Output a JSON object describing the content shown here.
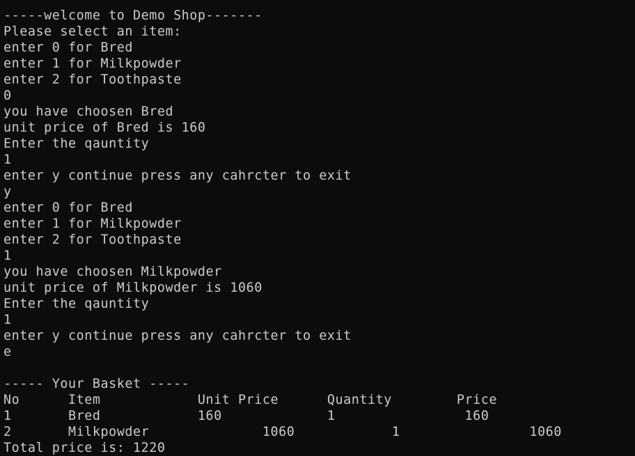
{
  "terminal": {
    "lines": [
      "",
      "-----welcome to Demo Shop-------",
      "Please select an item:",
      "enter 0 for Bred",
      "enter 1 for Milkpowder",
      "enter 2 for Toothpaste",
      "0",
      "you have choosen Bred",
      "unit price of Bred is 160",
      "Enter the qauntity",
      "1",
      "enter y continue press any cahrcter to exit",
      "y",
      "enter 0 for Bred",
      "enter 1 for Milkpowder",
      "enter 2 for Toothpaste",
      "1",
      "you have choosen Milkpowder",
      "unit price of Milkpowder is 1060",
      "Enter the qauntity",
      "1",
      "enter y continue press any cahrcter to exit",
      "e",
      "",
      "----- Your Basket -----",
      "No      Item            Unit Price      Quantity        Price",
      "1       Bred            160             1                160",
      "2       Milkpowder              1060            1                1060",
      "Total price is: 1220"
    ]
  }
}
